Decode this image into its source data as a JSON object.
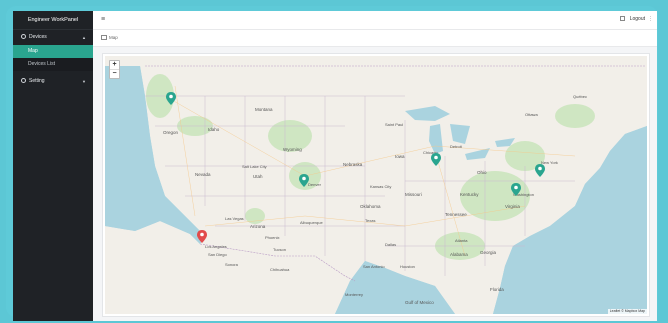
{
  "sidebar": {
    "brand": "Engineer WorkPanel",
    "groups": [
      {
        "label": "Devices",
        "expanded": true,
        "items": [
          {
            "label": "Map",
            "active": true
          },
          {
            "label": "Devices List",
            "active": false
          }
        ]
      },
      {
        "label": "Setting",
        "expanded": false,
        "items": []
      }
    ]
  },
  "header": {
    "menu_icon": "hamburger-icon",
    "fullscreen_icon": "fullscreen-icon",
    "logout_label": "Logout",
    "more_icon": "more-icon"
  },
  "breadcrumb": "Map",
  "map": {
    "zoom_in": "+",
    "zoom_out": "−",
    "attribution": "Leaflet © Mapbox Map",
    "colors": {
      "water": "#aad3df",
      "land": "#f2efe9",
      "green_marker": "#2aa58f",
      "red_marker": "#e24b4b"
    },
    "labels": [
      "Las Vegas",
      "Los Angeles",
      "Albuquerque",
      "Phoenix",
      "Denver",
      "Salt Lake City",
      "Kansas City",
      "Chicago",
      "Texas",
      "Houston",
      "Dallas",
      "Atlanta",
      "Washington",
      "New York",
      "Saint Paul",
      "Detroit",
      "Tucson",
      "San Antonio",
      "Monterrey",
      "Ottawa",
      "Québec",
      "Montana",
      "Nevada",
      "Utah",
      "Oregon",
      "Idaho",
      "Wyoming",
      "Nebraska",
      "Iowa",
      "Missouri",
      "Oklahoma",
      "Arizona",
      "Georgia",
      "Alabama",
      "Tennessee",
      "Kentucky",
      "Ohio",
      "Virginia",
      "Florida",
      "Gulf of Mexico",
      "Chihuahua",
      "Sonora",
      "San Diego"
    ],
    "markers": [
      {
        "name": "Seattle",
        "color": "green"
      },
      {
        "name": "Denver",
        "color": "green"
      },
      {
        "name": "Chicago",
        "color": "green"
      },
      {
        "name": "Washington",
        "color": "green"
      },
      {
        "name": "New York",
        "color": "green"
      },
      {
        "name": "Los Angeles",
        "color": "red"
      }
    ]
  }
}
